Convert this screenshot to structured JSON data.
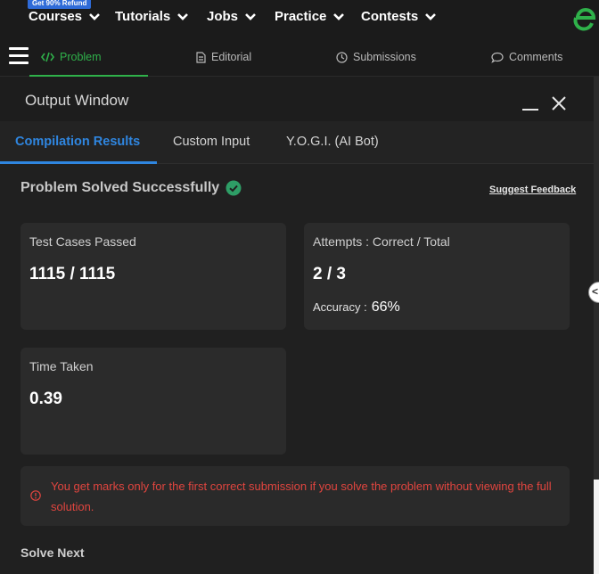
{
  "topnav": {
    "badge": "Get 90% Refund",
    "items": [
      "Courses",
      "Tutorials",
      "Jobs",
      "Practice",
      "Contests"
    ]
  },
  "problem_tabs": [
    {
      "label": "Problem",
      "icon": "code-icon"
    },
    {
      "label": "Editorial",
      "icon": "document-icon"
    },
    {
      "label": "Submissions",
      "icon": "clock-icon"
    },
    {
      "label": "Comments",
      "icon": "comment-icon"
    }
  ],
  "output_window": {
    "title": "Output Window",
    "tabs": [
      "Compilation Results",
      "Custom Input",
      "Y.O.G.I. (AI Bot)"
    ],
    "headline": "Problem Solved Successfully",
    "suggest_feedback": "Suggest Feedback",
    "cards": {
      "tests": {
        "label": "Test Cases Passed",
        "value": "1115 / 1115"
      },
      "attempts": {
        "label": "Attempts : Correct / Total",
        "value": "2 / 3",
        "accuracy_label": "Accuracy :",
        "accuracy_value": "66%"
      },
      "time": {
        "label": "Time Taken",
        "value": "0.39"
      }
    },
    "warning": "You get marks only for the first correct submission if you solve the problem without viewing the full solution.",
    "solve_next": "Solve Next"
  },
  "colors": {
    "accent_green": "#2fb14a",
    "accent_blue": "#2f86e0",
    "warning_red": "#e0453f"
  }
}
